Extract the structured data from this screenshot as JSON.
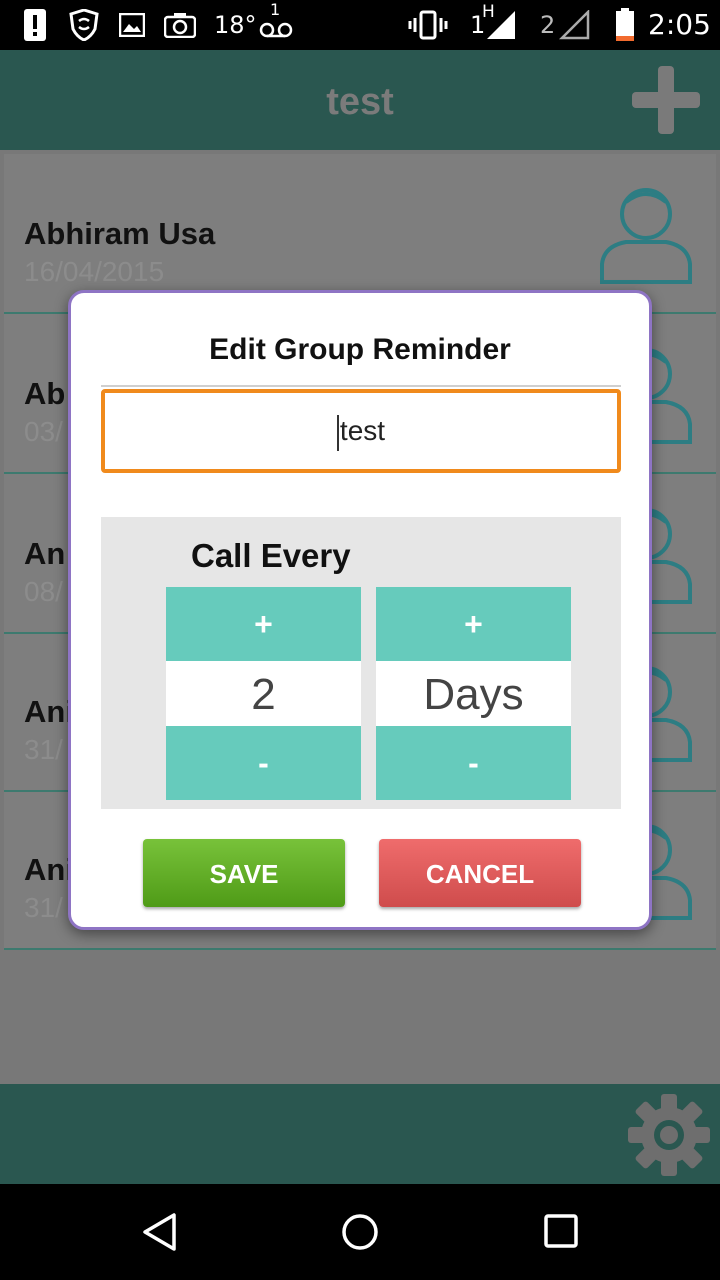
{
  "status_bar": {
    "temperature": "18°",
    "voicemail_count": "1",
    "sim1_label": "1",
    "sim1_network": "H",
    "sim2_label": "2",
    "time": "2:05",
    "icons": [
      "alert-icon",
      "shield-icon",
      "image-icon",
      "camera-icon",
      "voicemail-icon",
      "vibrate-icon",
      "signal-icon",
      "battery-icon"
    ]
  },
  "app_bar": {
    "title": "test",
    "add_icon": "plus-icon"
  },
  "list": {
    "items": [
      {
        "name": "Abhiram Usa",
        "date": "16/04/2015"
      },
      {
        "name": "Ab",
        "date": "03/"
      },
      {
        "name": "An",
        "date": "08/"
      },
      {
        "name": "Ani",
        "date": "31/"
      },
      {
        "name": "Ani",
        "date": "31/"
      }
    ]
  },
  "dialog": {
    "title": "Edit Group Reminder",
    "name_value": "test",
    "call_every_label": "Call Every",
    "count_picker": {
      "plus": "+",
      "value": "2",
      "minus": "-"
    },
    "unit_picker": {
      "plus": "+",
      "value": "Days",
      "minus": "-"
    },
    "save_label": "SAVE",
    "cancel_label": "CANCEL"
  },
  "colors": {
    "app_bar": "#2a5750",
    "accent_teal": "#66cbbc",
    "input_border": "#f08a1c",
    "save_green": "#5aab22",
    "cancel_red": "#e05a5a",
    "dialog_border": "#8e74c4"
  },
  "bottom_bar": {
    "settings_icon": "gear-icon"
  },
  "nav_bar": {
    "icons": [
      "back-icon",
      "home-icon",
      "recents-icon"
    ]
  }
}
